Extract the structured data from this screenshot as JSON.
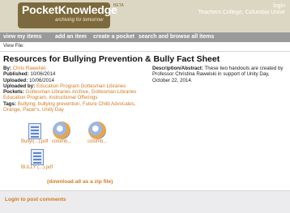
{
  "header": {
    "logo": "PocketKnowledge",
    "tagline": "archiving for tomorrow",
    "beta": "BETA",
    "login": "login",
    "institution": "Teachers College, Columbia Unive"
  },
  "nav": {
    "items": [
      "view my items",
      "add an item",
      "create a pocket",
      "search and browse all items"
    ]
  },
  "breadcrumb": "View File:",
  "page": {
    "title": "Resources for Bullying Prevention & Bully Fact Sheet",
    "by_label": "By:",
    "by": "Chris Rawelski",
    "published_label": "Published:",
    "published": "10/06/2014",
    "uploaded_label": "Uploaded:",
    "uploaded": "10/06/2014",
    "uploaded_by_label": "Uploaded by:",
    "uploaded_by": "Education Program Gottesman Libraries",
    "pockets_label": "Pockets:",
    "pockets": "Gottesman Libraries Archive, Gottesman Libraries Education Program, Instructional Offerings",
    "tags_label": "Tags:",
    "tags": "Bullying, bullying prevention, Future Child Advocates, Orange, Pacer's, Unity Day",
    "description_label": "Description/Abstract:",
    "description": "These two handouts are created by Professor Christina Rawelski in support of Unity Day, October 22, 2014."
  },
  "files": [
    {
      "label": "Bullyi(...).pdf",
      "icon": "pdf-icon"
    },
    {
      "label": "columb...",
      "icon": "document-icon"
    },
    {
      "label": "columb...",
      "icon": "document-icon"
    },
    {
      "label": "BULLY (...).pdf",
      "icon": "pdf-icon"
    }
  ],
  "zip_link": "(download all as a zip file)",
  "comments": {
    "login_link": "Login to post comments"
  },
  "colors": {
    "header_bg": "#dcd7c3",
    "logo_brown": "#7c6a3e",
    "nav_bg": "#9a9a9a",
    "link_orange": "#d07b24"
  }
}
